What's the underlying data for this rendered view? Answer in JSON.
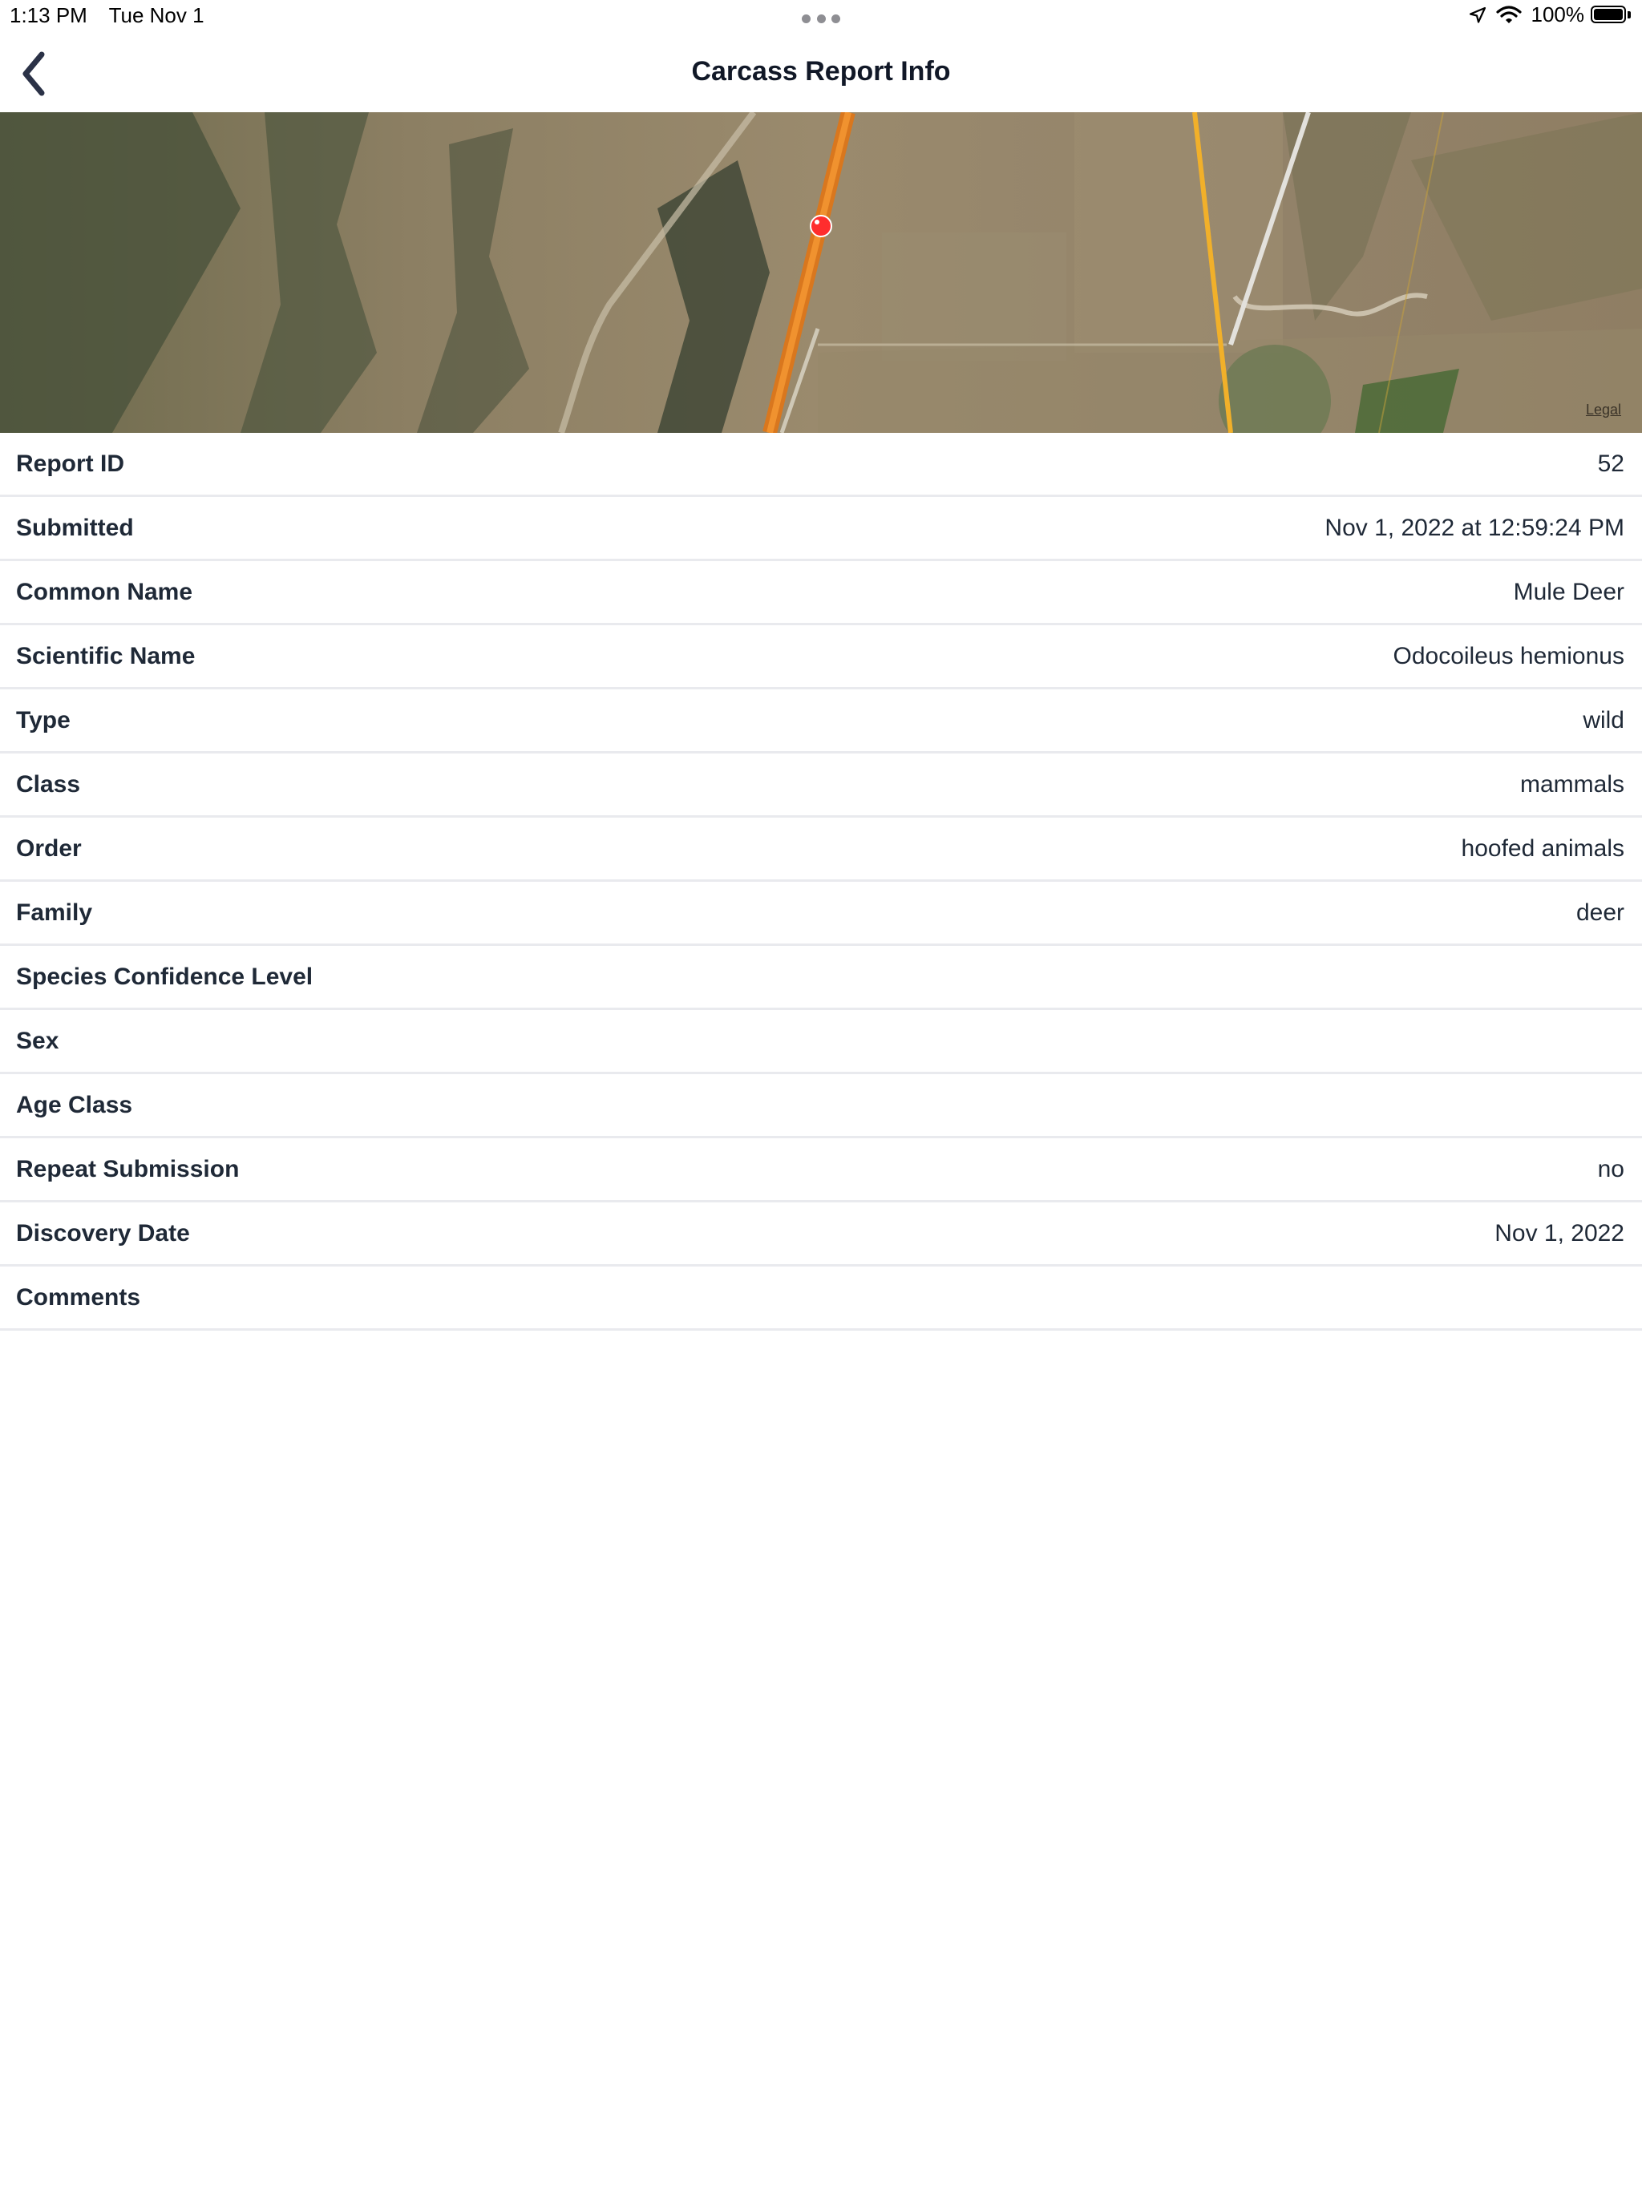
{
  "status_bar": {
    "time": "1:13 PM",
    "date": "Tue Nov 1",
    "battery_percent": "100%",
    "icons": [
      "location-arrow-icon",
      "wifi-icon",
      "battery-icon"
    ]
  },
  "nav": {
    "title": "Carcass Report Info",
    "back_icon": "chevron-left-icon"
  },
  "map": {
    "type": "satellite",
    "legal_label": "Legal",
    "pin_color": "#ff2d2d",
    "road_colors": [
      "#e07b22",
      "#f2b22e",
      "#d9d9d9"
    ]
  },
  "details": [
    {
      "label": "Report ID",
      "value": "52"
    },
    {
      "label": "Submitted",
      "value": "Nov 1, 2022 at 12:59:24 PM"
    },
    {
      "label": "Common Name",
      "value": "Mule Deer"
    },
    {
      "label": "Scientific Name",
      "value": "Odocoileus hemionus"
    },
    {
      "label": "Type",
      "value": "wild"
    },
    {
      "label": "Class",
      "value": "mammals"
    },
    {
      "label": "Order",
      "value": "hoofed animals"
    },
    {
      "label": "Family",
      "value": "deer"
    },
    {
      "label": "Species Confidence Level",
      "value": ""
    },
    {
      "label": "Sex",
      "value": ""
    },
    {
      "label": "Age Class",
      "value": ""
    },
    {
      "label": "Repeat Submission",
      "value": "no"
    },
    {
      "label": "Discovery Date",
      "value": "Nov 1, 2022"
    },
    {
      "label": "Comments",
      "value": ""
    }
  ]
}
